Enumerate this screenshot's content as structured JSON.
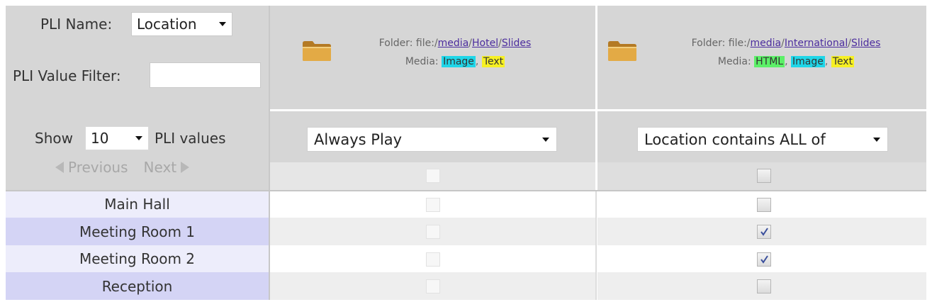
{
  "left_panel": {
    "pli_name_label": "PLI Name:",
    "pli_name_value": "Location",
    "value_filter_label": "PLI Value Filter:",
    "value_filter_value": "",
    "show_label": "Show",
    "show_count": "10",
    "pli_values_label": "PLI values",
    "previous_label": "Previous",
    "next_label": "Next"
  },
  "columns": [
    {
      "folder_prefix": "Folder: file:/",
      "path_parts": [
        "media",
        "Hotel",
        "Slides"
      ],
      "media_label": "Media:",
      "media_tags": [
        "Image",
        "Text"
      ],
      "rule": "Always Play",
      "select_all_checked": false,
      "enabled": false
    },
    {
      "folder_prefix": "Folder: file:/",
      "path_parts": [
        "media",
        "International",
        "Slides"
      ],
      "media_label": "Media:",
      "media_tags": [
        "HTML",
        "Image",
        "Text"
      ],
      "rule": "Location contains ALL of",
      "select_all_checked": false,
      "enabled": true
    }
  ],
  "rows": [
    {
      "label": "Main Hall",
      "col1_checked": false,
      "col2_checked": false
    },
    {
      "label": "Meeting Room 1",
      "col1_checked": false,
      "col2_checked": true
    },
    {
      "label": "Meeting Room 2",
      "col1_checked": false,
      "col2_checked": true
    },
    {
      "label": "Reception",
      "col1_checked": false,
      "col2_checked": false
    }
  ],
  "colors": {
    "header_gray": "#d6d6d6",
    "row_light": "#ededfb",
    "row_dark": "#d4d4f5",
    "tag_image": "#1fd6e8",
    "tag_text": "#f6f024",
    "tag_html": "#5cf068",
    "link": "#4b2c9e"
  }
}
